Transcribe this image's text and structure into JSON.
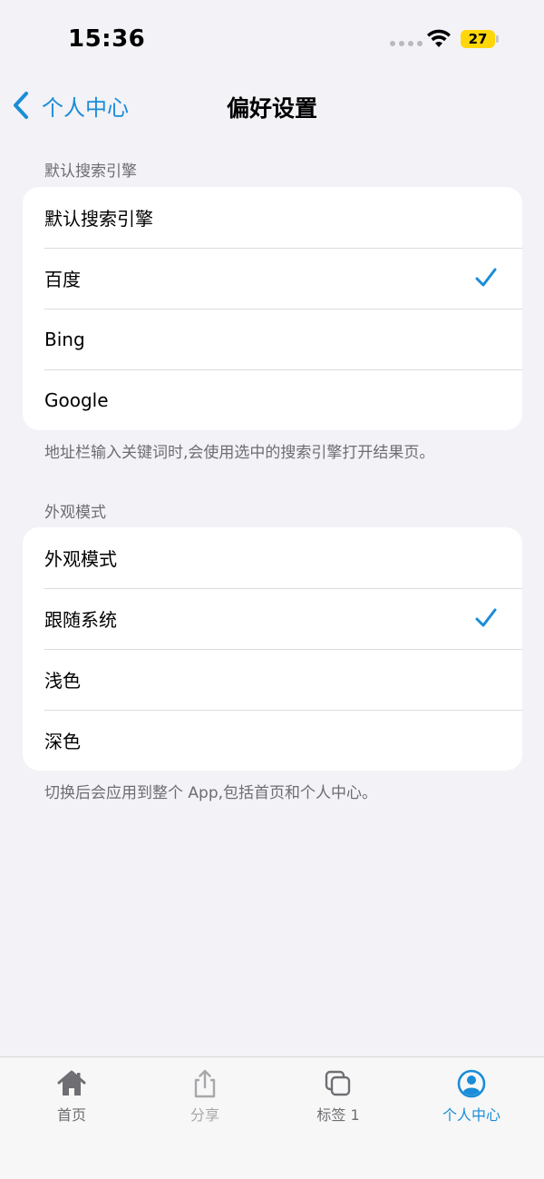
{
  "status": {
    "time": "15:36",
    "battery": "27"
  },
  "nav": {
    "back_label": "个人中心",
    "title": "偏好设置"
  },
  "search_section": {
    "header": "默认搜索引擎",
    "title_row": "默认搜索引擎",
    "options": [
      {
        "label": "百度",
        "selected": true
      },
      {
        "label": "Bing",
        "selected": false
      },
      {
        "label": "Google",
        "selected": false
      }
    ],
    "footer": "地址栏输入关键词时,会使用选中的搜索引擎打开结果页。"
  },
  "appearance_section": {
    "header": "外观模式",
    "title_row": "外观模式",
    "options": [
      {
        "label": "跟随系统",
        "selected": true
      },
      {
        "label": "浅色",
        "selected": false
      },
      {
        "label": "深色",
        "selected": false
      }
    ],
    "footer": "切换后会应用到整个 App,包括首页和个人中心。"
  },
  "tabs": [
    {
      "label": "首页",
      "icon": "house-icon",
      "active": false
    },
    {
      "label": "分享",
      "icon": "share-icon",
      "active": false
    },
    {
      "label": "标签 1",
      "icon": "tabs-icon",
      "active": false
    },
    {
      "label": "个人中心",
      "icon": "person-circle-icon",
      "active": true
    }
  ],
  "colors": {
    "accent": "#1a8cd8",
    "background": "#f2f2f7",
    "secondary_text": "#6d6d72",
    "battery": "#ffd60a"
  }
}
